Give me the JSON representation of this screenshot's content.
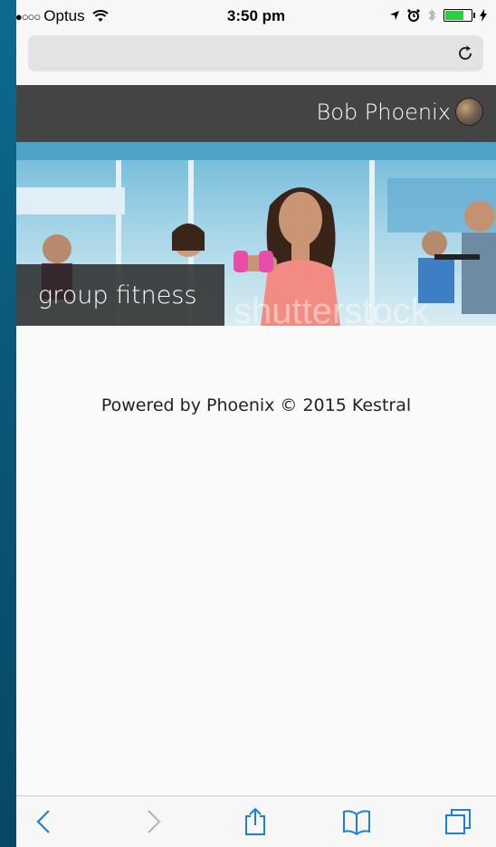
{
  "status_bar": {
    "signal": "●●○○○",
    "carrier": "Optus",
    "time": "3:50 pm",
    "battery_level": 0.65
  },
  "browser": {
    "url_value": "",
    "icons": {
      "reload": "reload-icon",
      "back": "chevron-left-icon",
      "forward": "chevron-right-icon",
      "share": "share-icon",
      "bookmarks": "book-icon",
      "tabs": "tabs-icon"
    }
  },
  "header": {
    "user_name": "Bob Phoenix"
  },
  "banner": {
    "label": "group fitness",
    "watermark": "shutterstock"
  },
  "footer": {
    "text": "Powered by Phoenix © 2015 Kestral"
  },
  "colors": {
    "header_bg": "#444444",
    "page_bg": "#fafafa",
    "toolbar_accent": "#1a7fe0"
  }
}
